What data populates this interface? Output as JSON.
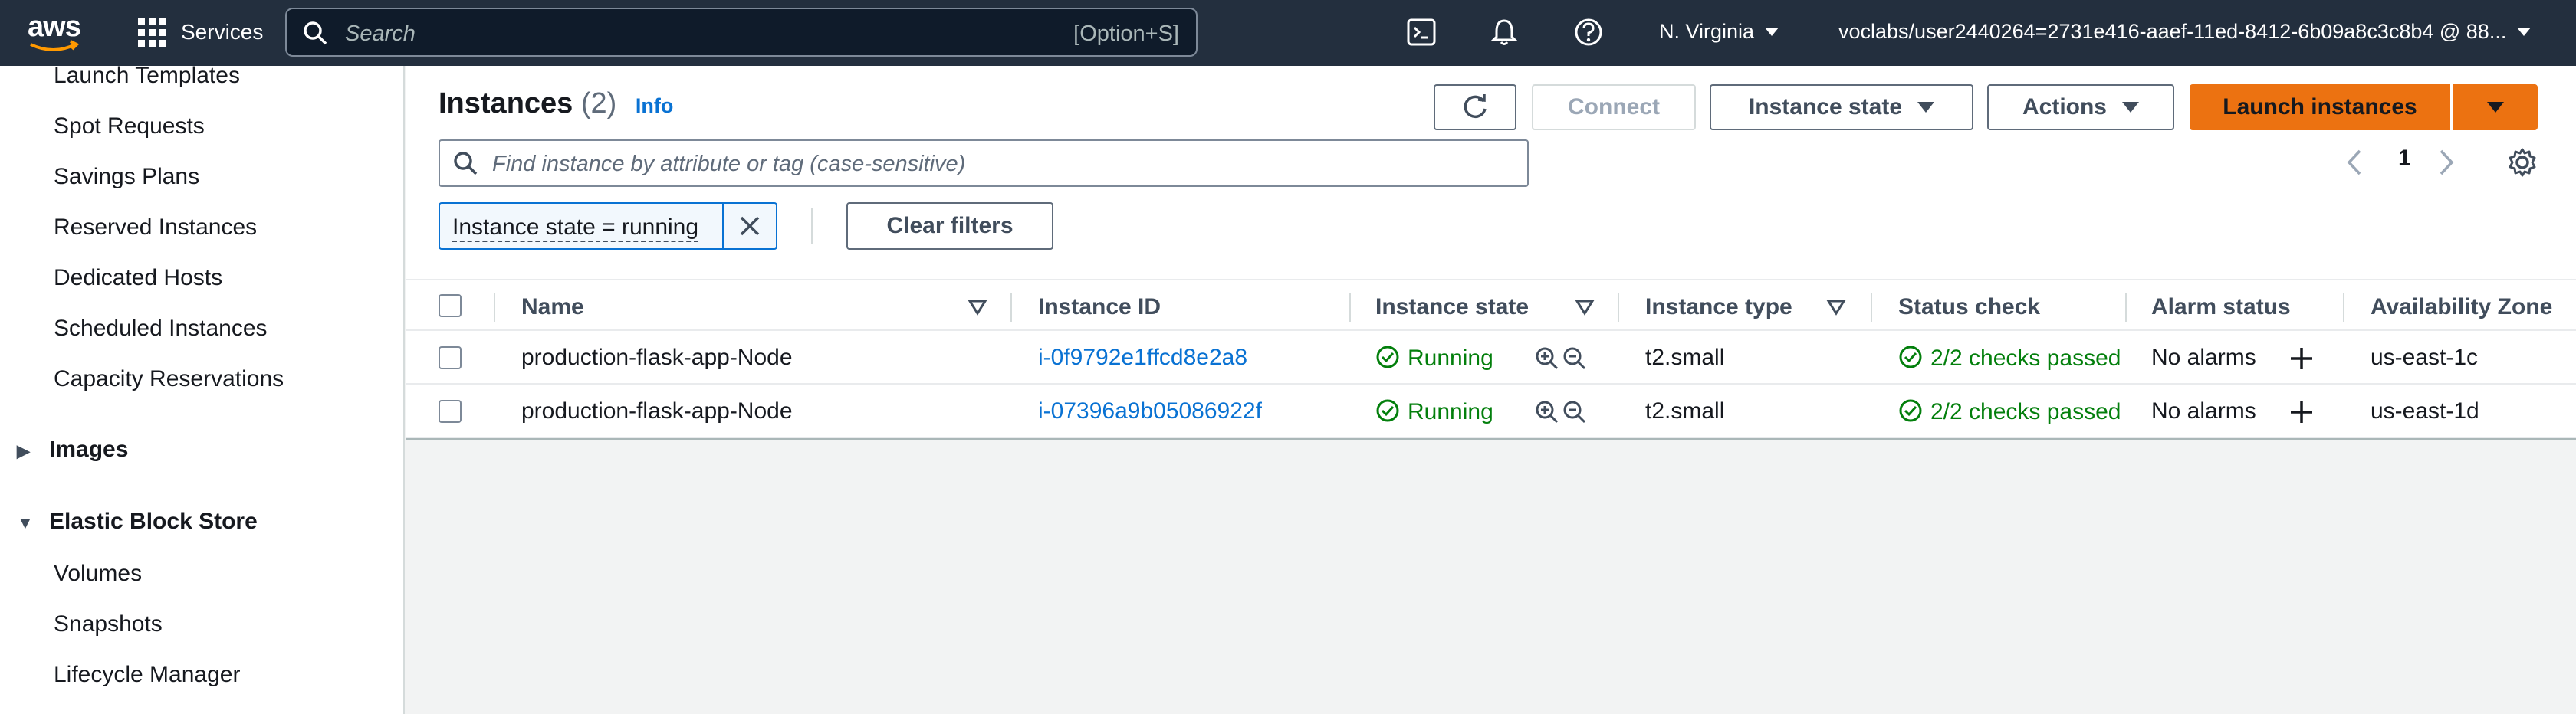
{
  "topbar": {
    "logo": "aws",
    "services": "Services",
    "search_placeholder": "Search",
    "search_shortcut": "[Option+S]",
    "region": "N. Virginia",
    "account": "voclabs/user2440264=2731e416-aaef-11ed-8412-6b09a8c3c8b4 @ 88...",
    "icons": [
      "cloudshell-icon",
      "notifications-icon",
      "help-icon"
    ]
  },
  "sidebar": {
    "items_top": [
      "Launch Templates",
      "Spot Requests",
      "Savings Plans",
      "Reserved Instances",
      "Dedicated Hosts",
      "Scheduled Instances",
      "Capacity Reservations"
    ],
    "section_images": "Images",
    "section_ebs": "Elastic Block Store",
    "ebs_items": [
      "Volumes",
      "Snapshots",
      "Lifecycle Manager"
    ]
  },
  "main": {
    "title": "Instances",
    "count": "(2)",
    "info": "Info",
    "connect": "Connect",
    "instance_state": "Instance state",
    "actions": "Actions",
    "launch": "Launch instances",
    "find_placeholder": "Find instance by attribute or tag (case-sensitive)",
    "page": "1",
    "filter_token": "Instance state = running",
    "clear_filters": "Clear filters",
    "columns": [
      "Name",
      "Instance ID",
      "Instance state",
      "Instance type",
      "Status check",
      "Alarm status",
      "Availability Zone"
    ],
    "rows": [
      {
        "name": "production-flask-app-Node",
        "id": "i-0f9792e1ffcd8e2a8",
        "state": "Running",
        "type": "t2.small",
        "status": "2/2 checks passed",
        "alarm": "No alarms",
        "az": "us-east-1c"
      },
      {
        "name": "production-flask-app-Node",
        "id": "i-07396a9b05086922f",
        "state": "Running",
        "type": "t2.small",
        "status": "2/2 checks passed",
        "alarm": "No alarms",
        "az": "us-east-1d"
      }
    ]
  },
  "colors": {
    "topbar": "#232f3e",
    "accent": "#ec7211",
    "link": "#0972d3",
    "success": "#037f0c"
  }
}
